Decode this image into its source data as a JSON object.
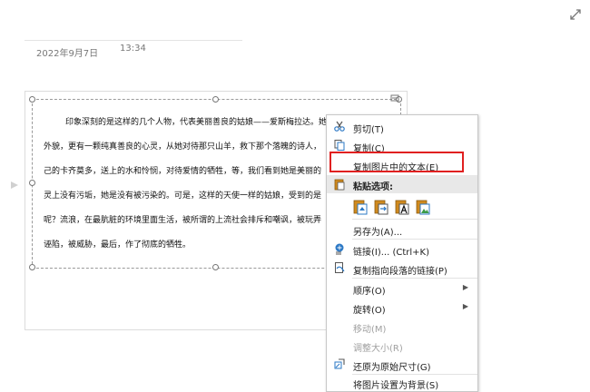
{
  "document": {
    "date": "2022年9月7日",
    "time": "13:34",
    "paragraph_lines": [
      "印象深刻的是这样的几个人物，代表美丽善良的姑娘——爱斯梅拉达。她",
      "外貌，更有一颗纯真善良的心灵，从她对待那只山羊，救下那个落魄的诗人，",
      "己的卡齐莫多，送上的水和怜悯，对待爱情的牺牲，等，我们看到她是美丽的",
      "灵上没有污垢，她是没有被污染的。可是，这样的天使一样的姑娘，受到的是",
      "呢？流浪，在最肮脏的环境里面生活，被所谓的上流社会排斥和嘲讽，被玩弄",
      "诬陷，被威胁，最后，作了彻底的牺牲。"
    ]
  },
  "context_menu": {
    "cut": "剪切(T)",
    "copy": "复制(C)",
    "copy_text_in_image": "复制图片中的文本(E)",
    "paste_options_header": "粘贴选项:",
    "paste_options": [
      "keep-source-formatting-icon",
      "merge-formatting-icon",
      "keep-text-only-icon",
      "paste-as-picture-icon"
    ],
    "save_as": "另存为(A)...",
    "link": "链接(I)...   (Ctrl+K)",
    "copy_link_to_paragraph": "复制指向段落的链接(P)",
    "order": "顺序(O)",
    "rotate": "旋转(O)",
    "move": "移动(M)",
    "resize": "调整大小(R)",
    "restore_original_size": "还原为原始尺寸(G)",
    "set_as_background": "将图片设置为背景(S)"
  },
  "colors": {
    "highlight": "#e02020",
    "accent_blue": "#2b78c5",
    "accent_orange": "#d08a1e"
  }
}
